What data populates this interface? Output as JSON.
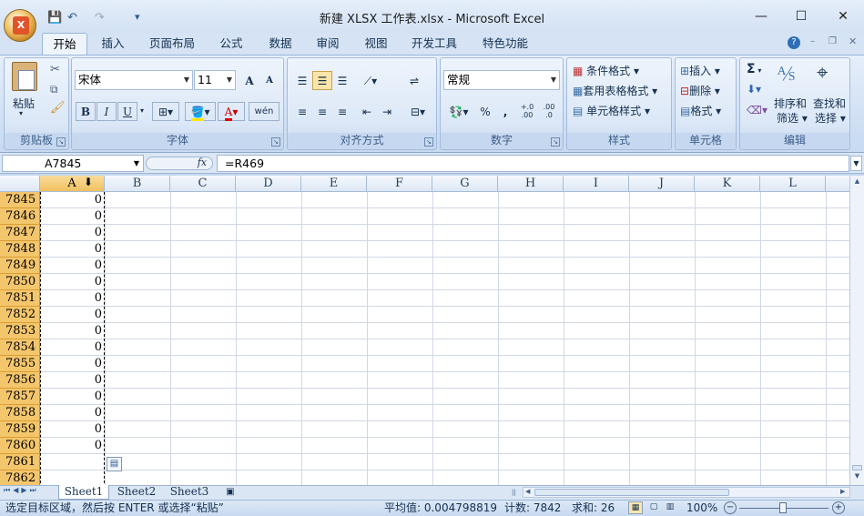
{
  "window": {
    "title": "新建 XLSX 工作表.xlsx - Microsoft Excel",
    "minimize": "—",
    "maximize": "☐",
    "close": "✕"
  },
  "office_button": {
    "glyph": "X"
  },
  "qat": {
    "save": "💾",
    "undo": "↶",
    "redo": "↷",
    "customize": "▾"
  },
  "tabs": [
    "开始",
    "插入",
    "页面布局",
    "公式",
    "数据",
    "审阅",
    "视图",
    "开发工具",
    "特色功能"
  ],
  "help": "?",
  "ribbon": {
    "clipboard": {
      "label": "剪贴板",
      "paste": "粘贴"
    },
    "font": {
      "label": "字体",
      "name": "宋体",
      "size": "11",
      "grow": "A",
      "shrink": "A",
      "bold": "B",
      "italic": "I",
      "underline": "U",
      "phonetic": "wén"
    },
    "alignment": {
      "label": "对齐方式"
    },
    "number": {
      "label": "数字",
      "format": "常规",
      "percent": "%",
      "comma": ",",
      "inc_decimal": "+.0 .00",
      "dec_decimal": ".00 .0"
    },
    "styles": {
      "label": "样式",
      "conditional": "条件格式",
      "table": "套用表格格式",
      "cell": "单元格样式"
    },
    "cells": {
      "label": "单元格",
      "insert": "插入",
      "delete": "删除",
      "format": "格式"
    },
    "editing": {
      "label": "编辑",
      "sum": "Σ",
      "sort": "排序和",
      "sort2": "筛选",
      "find": "查找和",
      "find2": "选择"
    }
  },
  "formula_bar": {
    "name_box": "A7845",
    "fx": "fx",
    "formula": "=R469"
  },
  "columns": [
    "A",
    "B",
    "C",
    "D",
    "E",
    "F",
    "G",
    "H",
    "I",
    "J",
    "K",
    "L"
  ],
  "rows": [
    {
      "num": "7845",
      "a": "0"
    },
    {
      "num": "7846",
      "a": "0"
    },
    {
      "num": "7847",
      "a": "0"
    },
    {
      "num": "7848",
      "a": "0"
    },
    {
      "num": "7849",
      "a": "0"
    },
    {
      "num": "7850",
      "a": "0"
    },
    {
      "num": "7851",
      "a": "0"
    },
    {
      "num": "7852",
      "a": "0"
    },
    {
      "num": "7853",
      "a": "0"
    },
    {
      "num": "7854",
      "a": "0"
    },
    {
      "num": "7855",
      "a": "0"
    },
    {
      "num": "7856",
      "a": "0"
    },
    {
      "num": "7857",
      "a": "0"
    },
    {
      "num": "7858",
      "a": "0"
    },
    {
      "num": "7859",
      "a": "0"
    },
    {
      "num": "7860",
      "a": "0"
    },
    {
      "num": "7861",
      "a": ""
    },
    {
      "num": "7862",
      "a": ""
    }
  ],
  "sheets": [
    "Sheet1",
    "Sheet2",
    "Sheet3"
  ],
  "status": {
    "message": "选定目标区域，然后按 ENTER 或选择“粘贴”",
    "average": "平均值: 0.004798819",
    "count": "计数: 7842",
    "sum": "求和: 26",
    "zoom": "100%"
  }
}
